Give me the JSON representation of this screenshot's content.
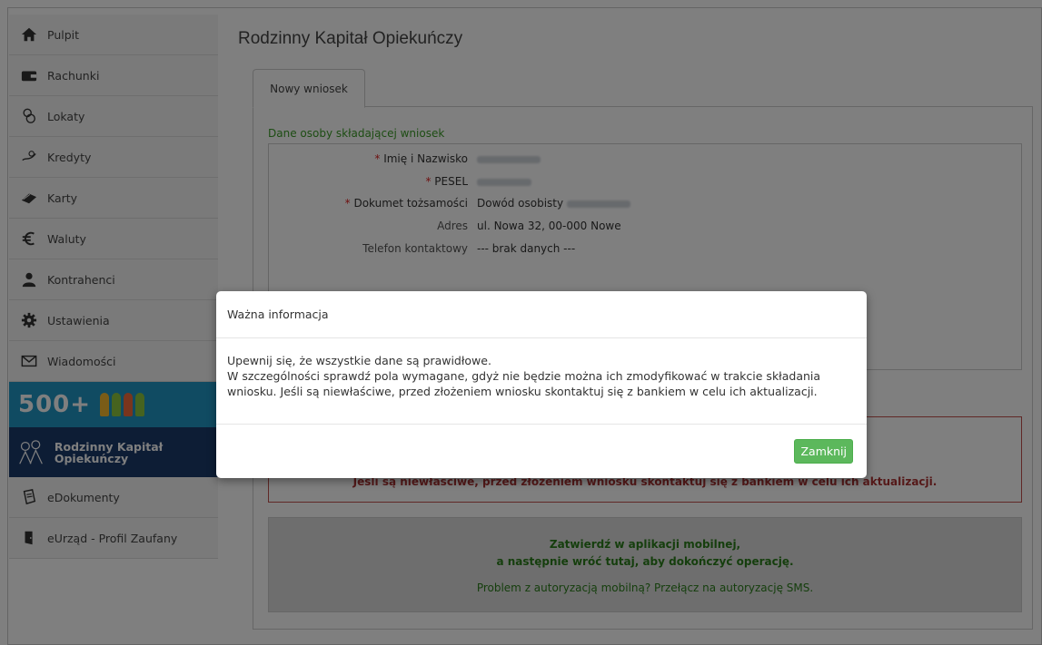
{
  "sidebar": {
    "items": [
      {
        "label": "Pulpit",
        "icon": "home-icon"
      },
      {
        "label": "Rachunki",
        "icon": "wallet-icon"
      },
      {
        "label": "Lokaty",
        "icon": "coins-icon"
      },
      {
        "label": "Kredyty",
        "icon": "hand-coins-icon"
      },
      {
        "label": "Karty",
        "icon": "card-icon"
      },
      {
        "label": "Waluty",
        "icon": "euro-icon"
      },
      {
        "label": "Kontrahenci",
        "icon": "user-tie-icon"
      },
      {
        "label": "Ustawienia",
        "icon": "gear-icon"
      },
      {
        "label": "Wiadomości",
        "icon": "envelope-icon"
      }
    ],
    "banner500": "500+",
    "bannerRKO": "Rodzinny Kapitał Opiekuńczy",
    "items_bottom": [
      {
        "label": "eDokumenty",
        "icon": "document-icon"
      },
      {
        "label": "eUrząd - Profil Zaufany",
        "icon": "door-icon"
      }
    ]
  },
  "main": {
    "title": "Rodzinny Kapitał Opiekuńczy",
    "tab": "Nowy wniosek",
    "section_title": "Dane osoby składającej wniosek",
    "fields": [
      {
        "label": "Imię i Nazwisko",
        "required": "*",
        "value": ""
      },
      {
        "label": "PESEL",
        "required": "*",
        "value": ""
      },
      {
        "label": "Dokumet tożsamości",
        "required": "*",
        "value": "Dowód osobisty"
      },
      {
        "label": "Adres",
        "required": "",
        "value": "ul. Nowa 32, 00-000 Nowe"
      },
      {
        "label": "Telefon kontaktowy",
        "required": "",
        "value": "--- brak danych ---"
      }
    ],
    "warning_line": "Jeśli są niewłaściwe, przed złożeniem wniosku skontaktuj się z bankiem w celu ich aktualizacji.",
    "auth": {
      "line1": "Zatwierdź w aplikacji mobilnej,",
      "line2": "a następnie wróć tutaj, aby dokończyć operację.",
      "line3": "Problem z autoryzacją mobilną? Przełącz na autoryzację SMS."
    }
  },
  "modal": {
    "title": "Ważna informacja",
    "body1": "Upewnij się, że wszystkie dane są prawidłowe.",
    "body2": "W szczególności sprawdź pola wymagane, gdyż nie będzie można ich zmodyfikować w trakcie składania wniosku. Jeśli są niewłaściwe, przed złożeniem wniosku skontaktuj się z bankiem w celu ich aktualizacji.",
    "close_label": "Zamknij"
  },
  "colors": {
    "accent_green": "#5cb85c",
    "section_green": "#3a9a26",
    "warn_red": "#c0504d"
  }
}
